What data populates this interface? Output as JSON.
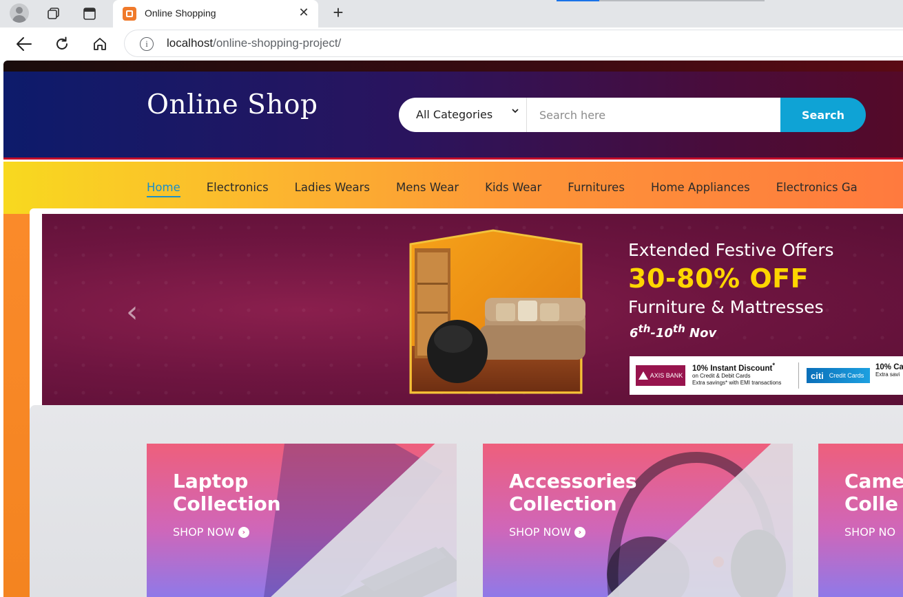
{
  "browser": {
    "tab_title": "Online Shopping",
    "close_glyph": "✕",
    "new_tab_glyph": "+",
    "url_host": "localhost",
    "url_path": "/online-shopping-project/"
  },
  "header": {
    "logo": "Online Shop",
    "category_selected": "All Categories",
    "search_placeholder": "Search here",
    "search_button": "Search"
  },
  "nav": {
    "items": [
      "Home",
      "Electronics",
      "Ladies Wears",
      "Mens Wear",
      "Kids Wear",
      "Furnitures",
      "Home Appliances",
      "Electronics Ga"
    ],
    "active": "Home"
  },
  "banner": {
    "prev_arrow": "‹",
    "heading": "Extended Festive Offers",
    "discount": "30-80% OFF",
    "category": "Furniture & Mattresses",
    "dates_start": "6",
    "dates_start_sup": "th",
    "dates_end": "-10",
    "dates_end_sup": "th",
    "dates_month": " Nov",
    "bank1_logo": "AXIS BANK",
    "bank1_offer": "10% Instant Discount",
    "bank1_offer_mark": "*",
    "bank1_line1": "on Credit & Debit Cards",
    "bank1_line2": "Extra savings* with EMI transactions",
    "bank2_logo": "citi",
    "bank2_logo_sub": "Credit Cards",
    "bank2_offer": "10% Ca",
    "bank2_line1": "Extra savi"
  },
  "collections": [
    {
      "title_line1": "Laptop",
      "title_line2": "Collection",
      "cta": "SHOP NOW"
    },
    {
      "title_line1": "Accessories",
      "title_line2": "Collection",
      "cta": "SHOP NOW"
    },
    {
      "title_line1": "Came",
      "title_line2": "Colle",
      "cta": "SHOP NO"
    }
  ],
  "colors": {
    "accent_blue": "#0fa3d5",
    "nav_active": "#1a8fc9",
    "offer_yellow": "#ffd600",
    "header_red_line": "#c40d2a"
  },
  "icons": {
    "profile": "profile-icon",
    "workspaces": "workspaces-icon",
    "tab_actions": "tab-actions-icon",
    "back": "back-arrow-icon",
    "reload": "reload-icon",
    "home": "home-icon",
    "info": "info-icon",
    "prev": "chevron-left-icon",
    "cta": "arrow-circle-right-icon"
  }
}
